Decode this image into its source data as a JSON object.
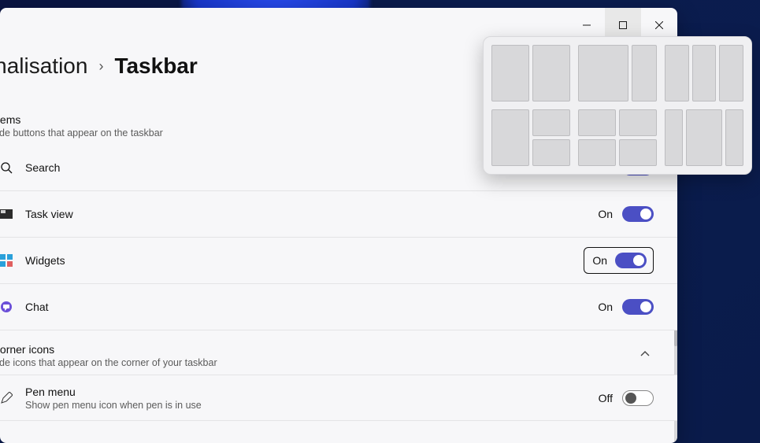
{
  "breadcrumb": {
    "parent": "Personalisation",
    "current": "Taskbar"
  },
  "sections": {
    "items": {
      "title": "Taskbar items",
      "subtitle": "Show or hide buttons that appear on the taskbar"
    },
    "corner": {
      "title": "Taskbar corner icons",
      "subtitle": "Show or hide icons that appear on the corner of your taskbar"
    }
  },
  "rows": {
    "search": {
      "label": "Search",
      "state": "On"
    },
    "taskview": {
      "label": "Task view",
      "state": "On"
    },
    "widgets": {
      "label": "Widgets",
      "state": "On"
    },
    "chat": {
      "label": "Chat",
      "state": "On"
    },
    "penmenu": {
      "label": "Pen menu",
      "sub": "Show pen menu icon when pen is in use",
      "state": "Off"
    }
  },
  "snap_layouts": [
    "50-50",
    "70-30",
    "33-33-33",
    "50-25-25-stack",
    "quad",
    "25-50-25"
  ]
}
